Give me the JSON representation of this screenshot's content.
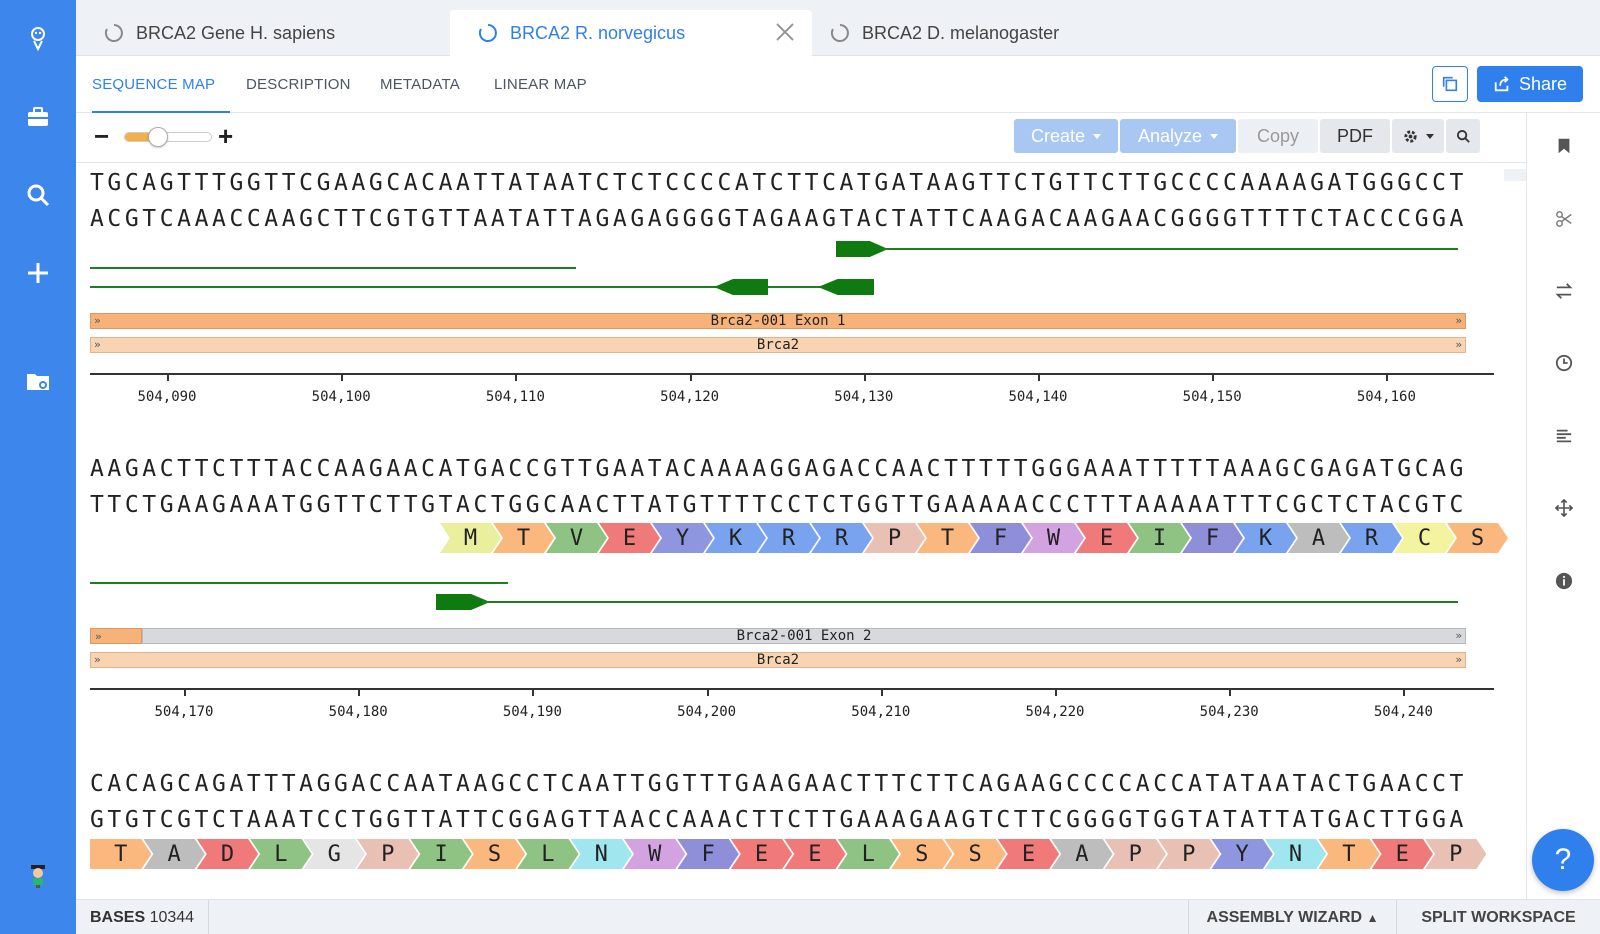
{
  "tabs": [
    {
      "label": "BRCA2 Gene H. sapiens",
      "active": false
    },
    {
      "label": "BRCA2 R. norvegicus",
      "active": true
    },
    {
      "label": "BRCA2 D. melanogaster",
      "active": false
    }
  ],
  "subnav": [
    "SEQUENCE MAP",
    "DESCRIPTION",
    "METADATA",
    "LINEAR MAP"
  ],
  "share_label": "Share",
  "toolbar": {
    "create": "Create",
    "analyze": "Analyze",
    "copy": "Copy",
    "pdf": "PDF"
  },
  "zoom_level": 0.38,
  "rows": [
    {
      "top": "TGCAGTTTGGTTCGAAGCACAATTATAATCTCTCCCCATCTTCATGATAAGTTCTGTTCTTGCCCCAAAAGATGGGCCT",
      "bottom": "ACGTCAAACCAAGCTTCGTGTTAATATTAGAGAGGGGTAGAAGTACTATTCAAGACAAGAACGGGGTTTTCTACCCGGA",
      "features": [
        {
          "label": "Brca2-001 Exon 1",
          "color": "#f7b27a"
        },
        {
          "label": "Brca2",
          "color": "#f9d4b2"
        }
      ],
      "ticks": [
        "504,090",
        "504,100",
        "504,110",
        "504,120",
        "504,130",
        "504,140",
        "504,150",
        "504,160"
      ]
    },
    {
      "top": "AAGACTTCTTTACCAAGAACATGACCGTTGAATACAAAAGGAGACCAACTTTTTGGGAAATTTTTAAAGCGAGATGCAG",
      "bottom": "TTCTGAAGAAATGGTTCTTGTACTGGCAACTTATGTTTTCCTCTGGTTGAAAAACCCTTTAAAAATTTCGCTCTACGTC",
      "aa": [
        "M",
        "T",
        "V",
        "E",
        "Y",
        "K",
        "R",
        "R",
        "P",
        "T",
        "F",
        "W",
        "E",
        "I",
        "F",
        "K",
        "A",
        "R",
        "C",
        "S"
      ],
      "features": [
        {
          "label": "Brca2-001 Exon 2",
          "color": "#d7d9dd"
        },
        {
          "label": "Brca2",
          "color": "#f9d4b2"
        }
      ],
      "ticks": [
        "504,170",
        "504,180",
        "504,190",
        "504,200",
        "504,210",
        "504,220",
        "504,230",
        "504,240"
      ]
    },
    {
      "top": "CACAGCAGATTTAGGACCAATAAGCCTCAATTGGTTTGAAGAACTTTCTTCAGAAGCCCCACCATATAATACTGAACCT",
      "bottom": "GTGTCGTCTAAATCCTGGTTATTCGGAGTTAACCAAACTTCTTGAAAGAAGTCTTCGGGGTGGTATATTATGACTTGGA",
      "aa": [
        "T",
        "A",
        "D",
        "L",
        "G",
        "P",
        "I",
        "S",
        "L",
        "N",
        "W",
        "F",
        "E",
        "E",
        "L",
        "S",
        "S",
        "E",
        "A",
        "P",
        "P",
        "Y",
        "N",
        "T",
        "E",
        "P"
      ]
    }
  ],
  "status": {
    "bases_label": "BASES",
    "bases_value": "10344",
    "wizard": "ASSEMBLY WIZARD",
    "split": "SPLIT WORKSPACE"
  },
  "help_label": "?",
  "aa_colors": {
    "M": "#e9ef9c",
    "T": "#fbb87e",
    "V": "#8fc383",
    "E": "#f07a7a",
    "Y": "#8f96e0",
    "K": "#7aa3ef",
    "R": "#7aa3ef",
    "P": "#e8c0b4",
    "F": "#8f8fd9",
    "W": "#d3a3e1",
    "I": "#8fc383",
    "A": "#bdbdbd",
    "C": "#f4f4a0",
    "S": "#fbb87e",
    "D": "#f07a7a",
    "L": "#8fc383",
    "G": "#e5e5e5",
    "N": "#9fe6ee"
  }
}
